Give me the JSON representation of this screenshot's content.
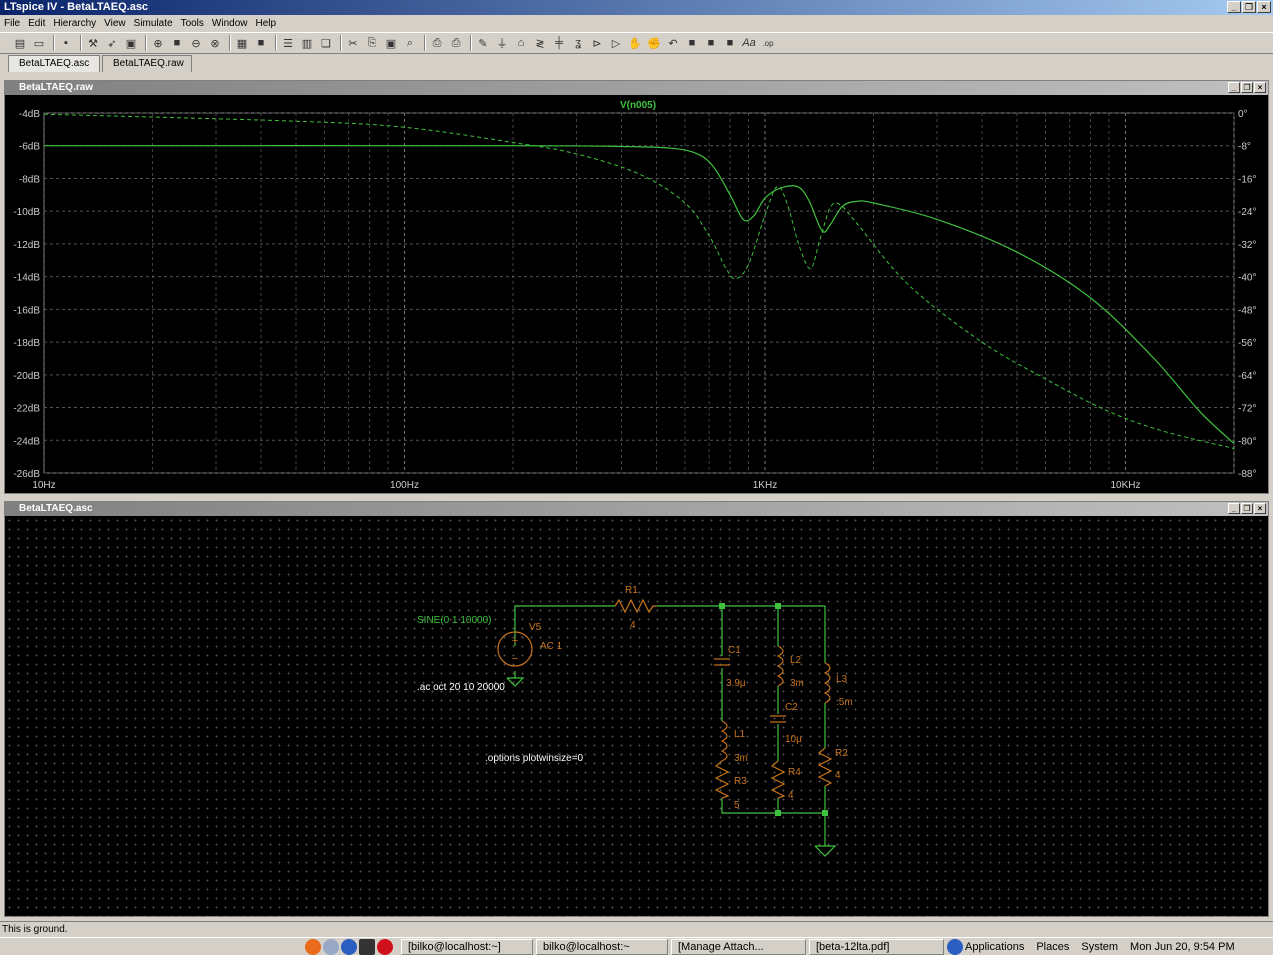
{
  "window": {
    "title": "LTspice IV - BetaLTAEQ.asc"
  },
  "menu": [
    "File",
    "Edit",
    "Hierarchy",
    "View",
    "Simulate",
    "Tools",
    "Window",
    "Help"
  ],
  "tabs": [
    {
      "label": "BetaLTAEQ.asc",
      "active": true
    },
    {
      "label": "BetaLTAEQ.raw",
      "active": false
    }
  ],
  "plot_window": {
    "title": "BetaLTAEQ.raw",
    "trace_label": "V(n005)"
  },
  "schematic_window": {
    "title": "BetaLTAEQ.asc"
  },
  "chart_data": {
    "type": "line",
    "xscale": "log",
    "xlim": [
      10,
      20000
    ],
    "x_ticks": [
      {
        "value": 10,
        "label": "10Hz"
      },
      {
        "value": 100,
        "label": "100Hz"
      },
      {
        "value": 1000,
        "label": "1KHz"
      },
      {
        "value": 10000,
        "label": "10KHz"
      }
    ],
    "ylim_left": [
      -26,
      -4
    ],
    "y_ticks_left": [
      "-4dB",
      "-6dB",
      "-8dB",
      "-10dB",
      "-12dB",
      "-14dB",
      "-16dB",
      "-18dB",
      "-20dB",
      "-22dB",
      "-24dB",
      "-26dB"
    ],
    "ylim_right": [
      -88,
      0
    ],
    "y_ticks_right": [
      "0°",
      "-8°",
      "-16°",
      "-24°",
      "-32°",
      "-40°",
      "-48°",
      "-56°",
      "-64°",
      "-72°",
      "-80°",
      "-88°"
    ],
    "grid": true,
    "series": [
      {
        "name": "V(n005)",
        "style": "solid",
        "axis": "left",
        "color": "#3fc23f",
        "points": [
          [
            10,
            -6
          ],
          [
            200,
            -6
          ],
          [
            400,
            -6.05
          ],
          [
            550,
            -6.15
          ],
          [
            650,
            -6.5
          ],
          [
            720,
            -7.3
          ],
          [
            800,
            -9
          ],
          [
            870,
            -10.5
          ],
          [
            930,
            -10.3
          ],
          [
            1000,
            -9.2
          ],
          [
            1100,
            -8.6
          ],
          [
            1230,
            -8.5
          ],
          [
            1320,
            -9.3
          ],
          [
            1440,
            -11.2
          ],
          [
            1520,
            -10.8
          ],
          [
            1640,
            -9.7
          ],
          [
            1800,
            -9.4
          ],
          [
            2000,
            -9.5
          ],
          [
            3000,
            -10.5
          ],
          [
            5000,
            -12.5
          ],
          [
            8000,
            -15.3
          ],
          [
            12000,
            -19
          ],
          [
            16000,
            -22.2
          ],
          [
            20000,
            -24.2
          ]
        ]
      },
      {
        "name": "phase",
        "style": "dashed",
        "axis": "right",
        "color": "#3fc23f",
        "points": [
          [
            10,
            -0.3
          ],
          [
            50,
            -2
          ],
          [
            100,
            -3.5
          ],
          [
            200,
            -7.2
          ],
          [
            300,
            -10
          ],
          [
            450,
            -15
          ],
          [
            600,
            -22
          ],
          [
            700,
            -30
          ],
          [
            780,
            -38
          ],
          [
            830,
            -40.5
          ],
          [
            900,
            -37
          ],
          [
            1000,
            -25
          ],
          [
            1080,
            -18
          ],
          [
            1150,
            -22
          ],
          [
            1250,
            -33
          ],
          [
            1340,
            -38
          ],
          [
            1420,
            -31
          ],
          [
            1520,
            -23
          ],
          [
            1620,
            -22.5
          ],
          [
            1800,
            -27
          ],
          [
            2500,
            -42
          ],
          [
            4000,
            -56
          ],
          [
            6000,
            -65
          ],
          [
            9000,
            -73
          ],
          [
            13000,
            -78
          ],
          [
            20000,
            -82
          ]
        ]
      }
    ]
  },
  "schematic": {
    "source_spec": "SINE(0 1 10000)",
    "source_name": "V5",
    "source_ac": "AC 1",
    "ac_directive": ".ac oct 20 10 20000",
    "options_directive": ".options plotwinsize=0",
    "components": [
      {
        "name": "R1",
        "value": "4"
      },
      {
        "name": "C1",
        "value": "3.9µ"
      },
      {
        "name": "L1",
        "value": "3m"
      },
      {
        "name": "R3",
        "value": "5"
      },
      {
        "name": "L2",
        "value": "3m"
      },
      {
        "name": "C2",
        "value": "10µ"
      },
      {
        "name": "R4",
        "value": "4"
      },
      {
        "name": "L3",
        "value": ".5m"
      },
      {
        "name": "R2",
        "value": "4"
      }
    ]
  },
  "status": {
    "text": "This is ground."
  },
  "taskbar": {
    "tasks": [
      "[bilko@localhost:~]",
      "bilko@localhost:~",
      "[Manage Attach...",
      "[beta-12lta.pdf]"
    ],
    "menus": [
      "Applications",
      "Places",
      "System"
    ],
    "clock": "Mon Jun 20,  9:54 PM"
  },
  "colors": {
    "trace": "#3fc23f",
    "wire": "#3fc23f",
    "component": "#c8741e",
    "directive": "#ffffff"
  }
}
